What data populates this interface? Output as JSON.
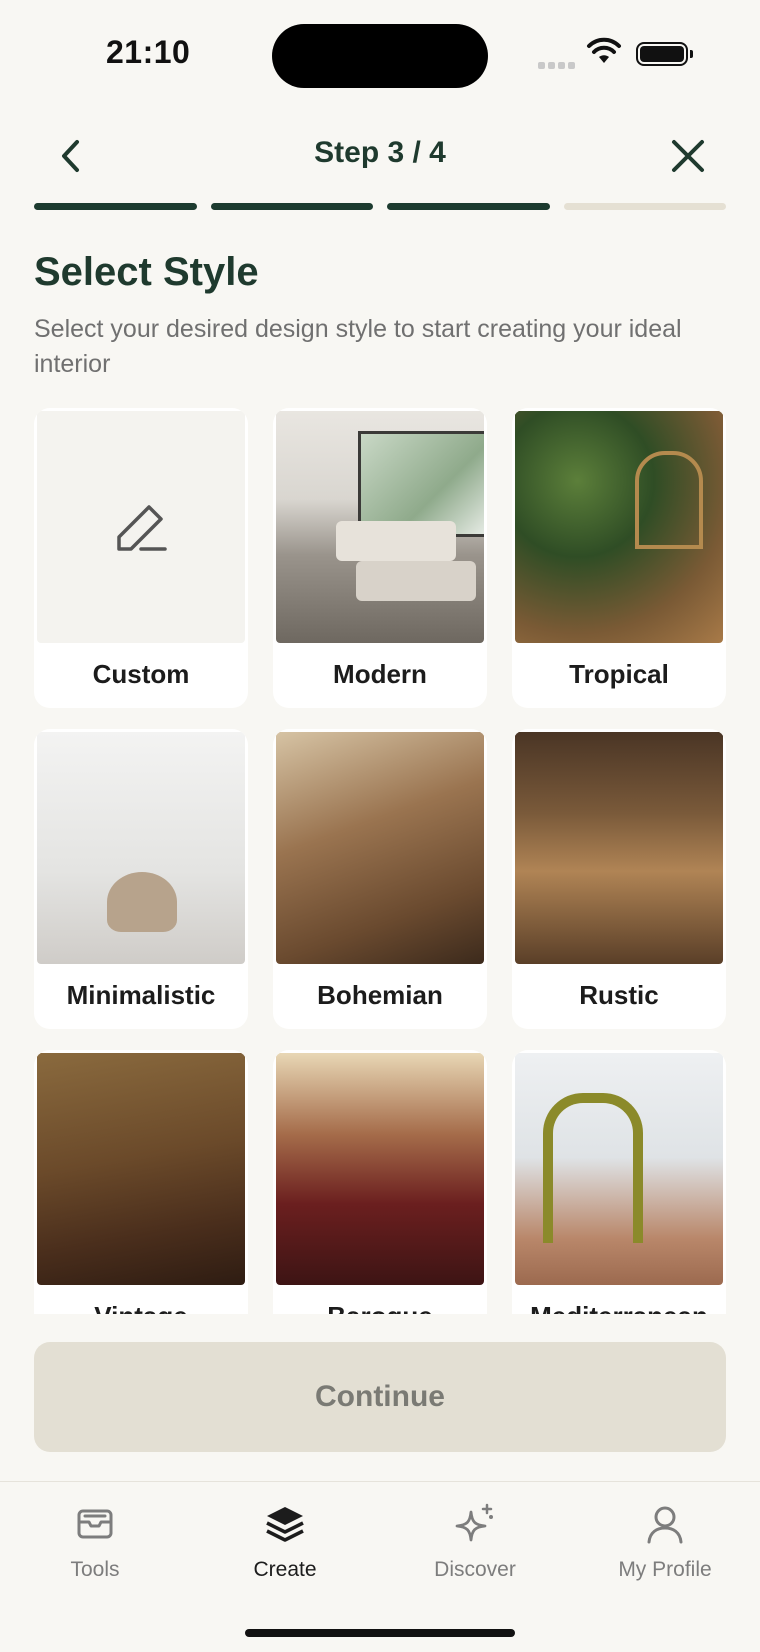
{
  "status": {
    "time": "21:10"
  },
  "header": {
    "step": "Step 3 / 4"
  },
  "progress": {
    "completed_steps": 3,
    "total_steps": 4
  },
  "page": {
    "title": "Select Style",
    "subtitle": "Select your desired design style to start creating your ideal interior"
  },
  "styles": [
    {
      "label": "Custom"
    },
    {
      "label": "Modern"
    },
    {
      "label": "Tropical"
    },
    {
      "label": "Minimalistic"
    },
    {
      "label": "Bohemian"
    },
    {
      "label": "Rustic"
    },
    {
      "label": "Vintage"
    },
    {
      "label": "Baroque"
    },
    {
      "label": "Mediterranean"
    }
  ],
  "actions": {
    "continue_label": "Continue"
  },
  "tabbar": [
    {
      "label": "Tools",
      "icon": "tools-icon"
    },
    {
      "label": "Create",
      "icon": "layers-icon"
    },
    {
      "label": "Discover",
      "icon": "sparkles-icon"
    },
    {
      "label": "My Profile",
      "icon": "user-icon"
    }
  ],
  "colors": {
    "accent": "#1d3b2f",
    "progress_inactive": "#e5e0d3",
    "button_disabled": "#e3dfd3",
    "background": "#f8f7f3"
  }
}
